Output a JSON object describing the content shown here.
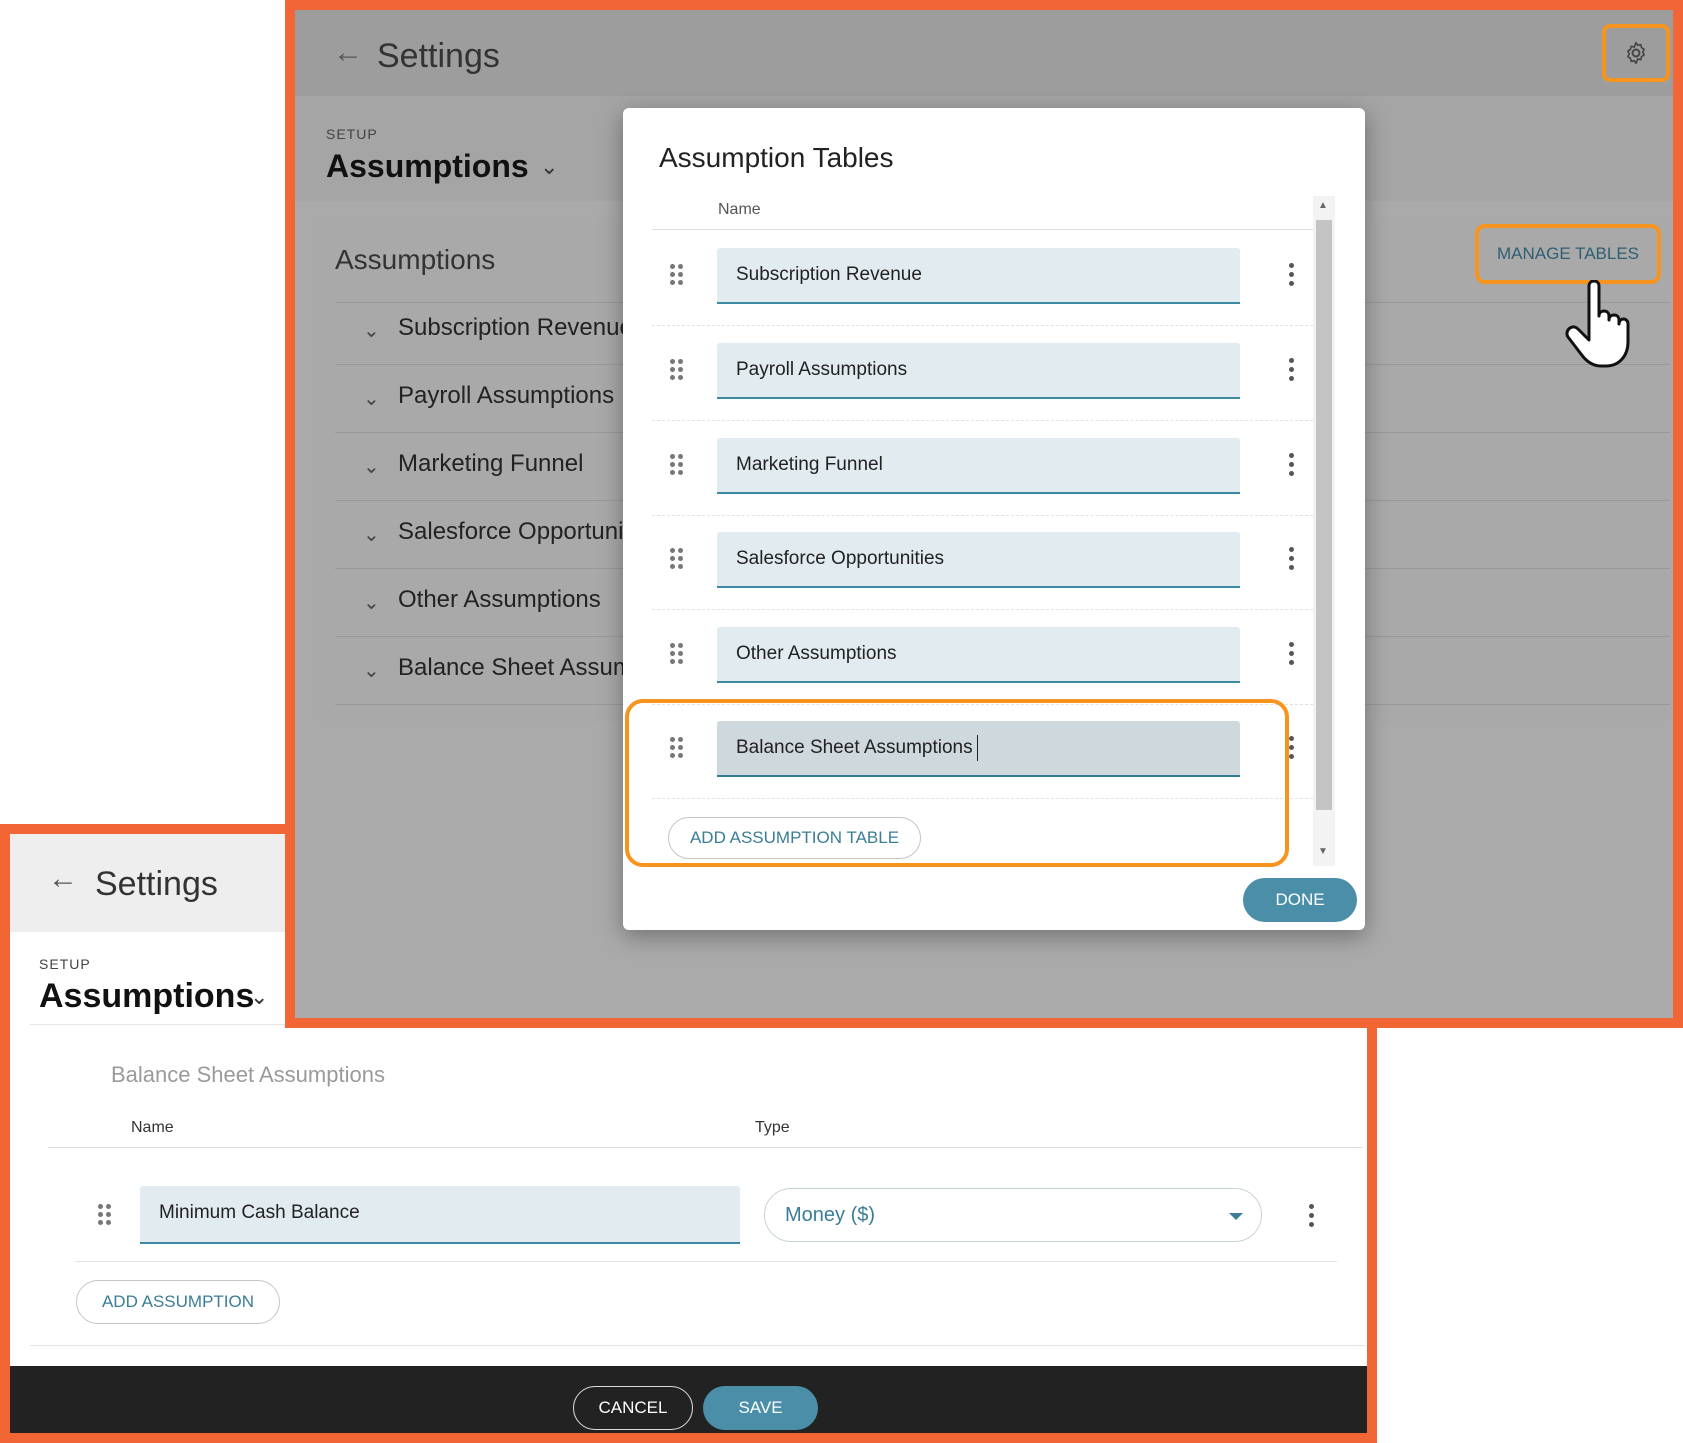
{
  "top_screen": {
    "header": {
      "back_icon": "arrow-left-icon",
      "title": "Settings",
      "gear_icon": "gear-icon"
    },
    "setup": {
      "label": "SETUP",
      "title": "Assumptions",
      "dropdown_icon": "chevron-down-icon"
    },
    "card": {
      "title": "Assumptions",
      "manage_tables_label": "MANAGE TABLES",
      "rows": [
        "Subscription Revenue",
        "Payroll Assumptions",
        "Marketing Funnel",
        "Salesforce Opportuniti",
        "Other Assumptions",
        "Balance Sheet Assump"
      ]
    },
    "modal": {
      "title": "Assumption Tables",
      "column_name": "Name",
      "tables": [
        "Subscription Revenue",
        "Payroll Assumptions",
        "Marketing Funnel",
        "Salesforce Opportunities",
        "Other Assumptions",
        "Balance Sheet Assumptions"
      ],
      "add_table_label": "ADD ASSUMPTION TABLE",
      "done_label": "DONE"
    }
  },
  "bottom_screen": {
    "header": {
      "back_icon": "arrow-left-icon",
      "title": "Settings"
    },
    "setup": {
      "label": "SETUP",
      "title": "Assumptions"
    },
    "section_title": "Balance Sheet Assumptions",
    "columns": {
      "name": "Name",
      "type": "Type"
    },
    "assumption": {
      "name": "Minimum Cash Balance",
      "type": "Money ($)"
    },
    "add_assumption_label": "ADD ASSUMPTION",
    "footer": {
      "cancel_label": "CANCEL",
      "save_label": "SAVE"
    }
  },
  "colors": {
    "highlight_orange": "#f7941d",
    "frame_orange": "#f26534",
    "accent_teal": "#4a8fa7"
  }
}
